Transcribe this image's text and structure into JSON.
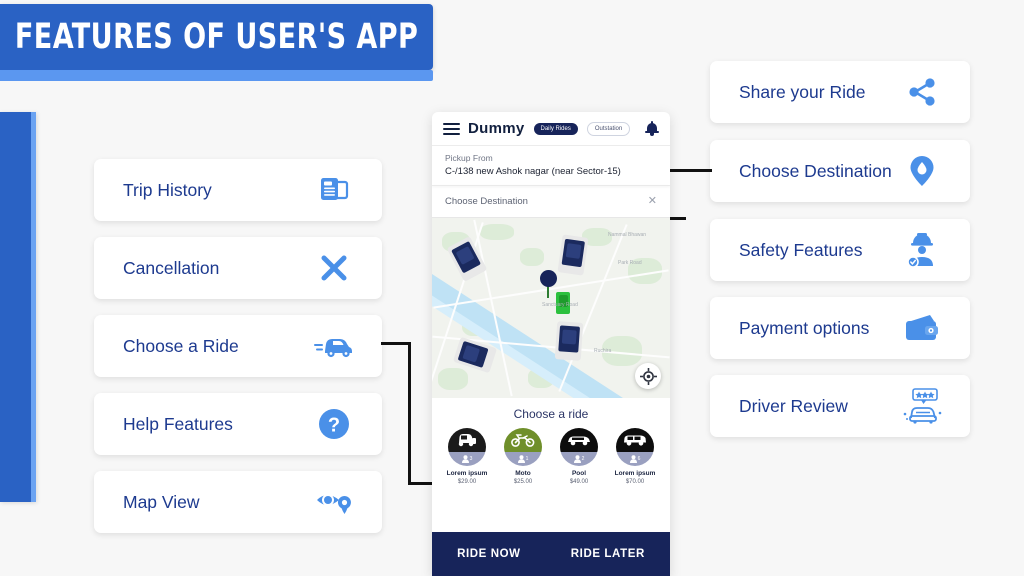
{
  "page": {
    "title": "FEATURES OF USER'S APP",
    "background_color": "#f7f7f7",
    "accent_blue": "#2a62c4",
    "accent_light_blue": "#5b97f0",
    "navy": "#17245a",
    "icon_blue": "#4a90e8"
  },
  "left_features": [
    {
      "label": "Trip History",
      "icon": "document-list-icon"
    },
    {
      "label": "Cancellation",
      "icon": "cross-icon"
    },
    {
      "label": "Choose a Ride",
      "icon": "car-icon"
    },
    {
      "label": "Help Features",
      "icon": "question-mark-icon"
    },
    {
      "label": "Map View",
      "icon": "map-eye-pin-icon"
    }
  ],
  "right_features": [
    {
      "label": "Share your Ride",
      "icon": "share-icon"
    },
    {
      "label": "Choose Destination",
      "icon": "location-pin-icon"
    },
    {
      "label": "Safety Features",
      "icon": "safety-helmet-icon"
    },
    {
      "label": "Payment options",
      "icon": "wallet-icon"
    },
    {
      "label": "Driver Review",
      "icon": "taxi-stars-icon"
    }
  ],
  "phone": {
    "header": {
      "menu_icon": "hamburger-icon",
      "brand": "Dummy",
      "tab_active": "Daily Rides",
      "tab_inactive": "Outstation",
      "notification_icon": "bell-icon"
    },
    "pickup": {
      "label": "Pickup From",
      "value": "C-/138 new Ashok nagar (near Sector-15)"
    },
    "destination": {
      "placeholder": "Choose Destination",
      "clear_icon": "close-icon"
    },
    "map": {
      "locate_icon": "crosshair-icon",
      "pin_icon": "map-pin-icon",
      "labels": [
        "Nammal Bhawan",
        "Ruchira",
        "Park Road",
        "Sanctuary Road"
      ]
    },
    "choose_ride_title": "Choose a ride",
    "ride_options": [
      {
        "name": "Lorem ipsum",
        "price": "$29.00",
        "seats": "3",
        "icon": "auto-rickshaw-icon",
        "color": "#1b1b1b"
      },
      {
        "name": "Moto",
        "price": "$25.00",
        "seats": "1",
        "icon": "motorbike-icon",
        "color": "#6f8f2a"
      },
      {
        "name": "Pool",
        "price": "$49.00",
        "seats": "2",
        "icon": "sedan-icon",
        "color": "#0d0d0d"
      },
      {
        "name": "Lorem ipsum",
        "price": "$70.00",
        "seats": "6",
        "icon": "suv-icon",
        "color": "#0d0d0d"
      }
    ],
    "cta": {
      "ride_now": "RIDE NOW",
      "ride_later": "RIDE LATER"
    }
  }
}
